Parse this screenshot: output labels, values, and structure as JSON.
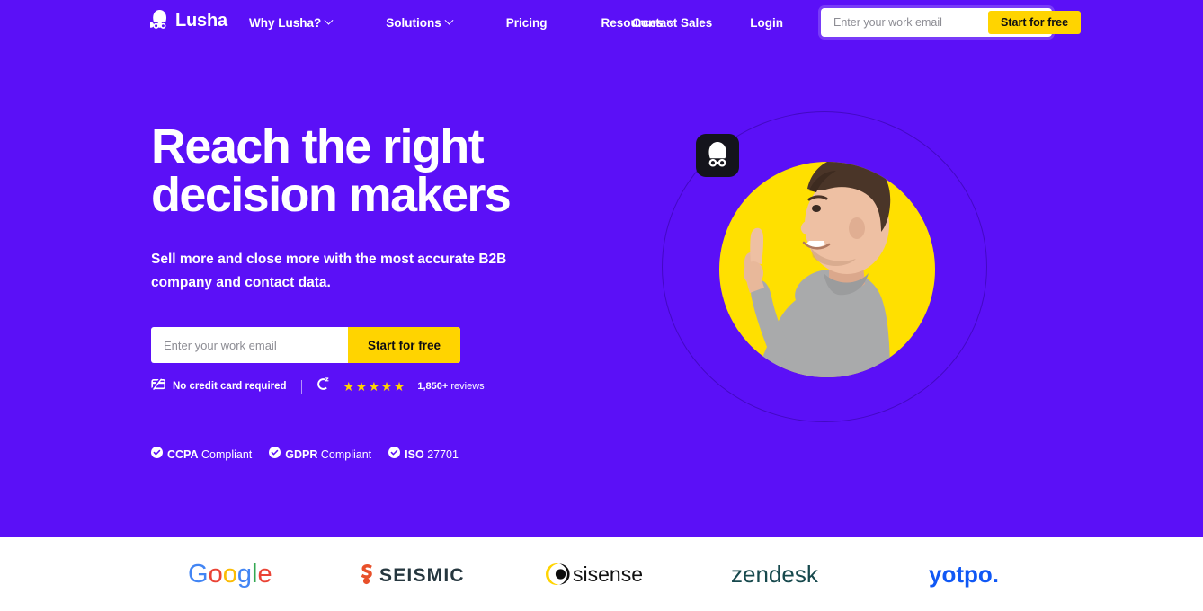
{
  "brand": {
    "name": "Lusha",
    "purple": "#5B10F7",
    "yellow": "#FFD400",
    "dark": "#14141c"
  },
  "nav": {
    "logo_text": "Lusha",
    "links": [
      {
        "label": "Why Lusha?",
        "has_caret": true
      },
      {
        "label": "Solutions",
        "has_caret": true
      },
      {
        "label": "Pricing",
        "has_caret": false
      },
      {
        "label": "Resources",
        "has_caret": true
      }
    ],
    "contact_sales": "Contact Sales",
    "login": "Login",
    "email_placeholder": "Enter your work email",
    "email_value": "",
    "cta_label": "Start for free"
  },
  "hero": {
    "title": "Reach the right\ndecision makers",
    "subtitle": "Sell more and close more with the most accurate B2B company and contact data.",
    "email_placeholder": "Enter your work email",
    "email_value": "",
    "cta_label": "Start for free",
    "no_credit_card": "No credit card required",
    "stars": "★★★★★",
    "star_count": 5,
    "reviews_count": "1,850+",
    "reviews_label": "reviews"
  },
  "compliance": [
    {
      "strong": "CCPA",
      "rest": "Compliant"
    },
    {
      "strong": "GDPR",
      "rest": "Compliant"
    },
    {
      "strong": "ISO",
      "rest": "27701"
    }
  ],
  "logos": [
    {
      "name": "Google",
      "key": "google"
    },
    {
      "name": "SEISMIC",
      "key": "seismic"
    },
    {
      "name": "sisense",
      "key": "sisense"
    },
    {
      "name": "zendesk",
      "key": "zendesk"
    },
    {
      "name": "yotpo.",
      "key": "yotpo"
    }
  ]
}
